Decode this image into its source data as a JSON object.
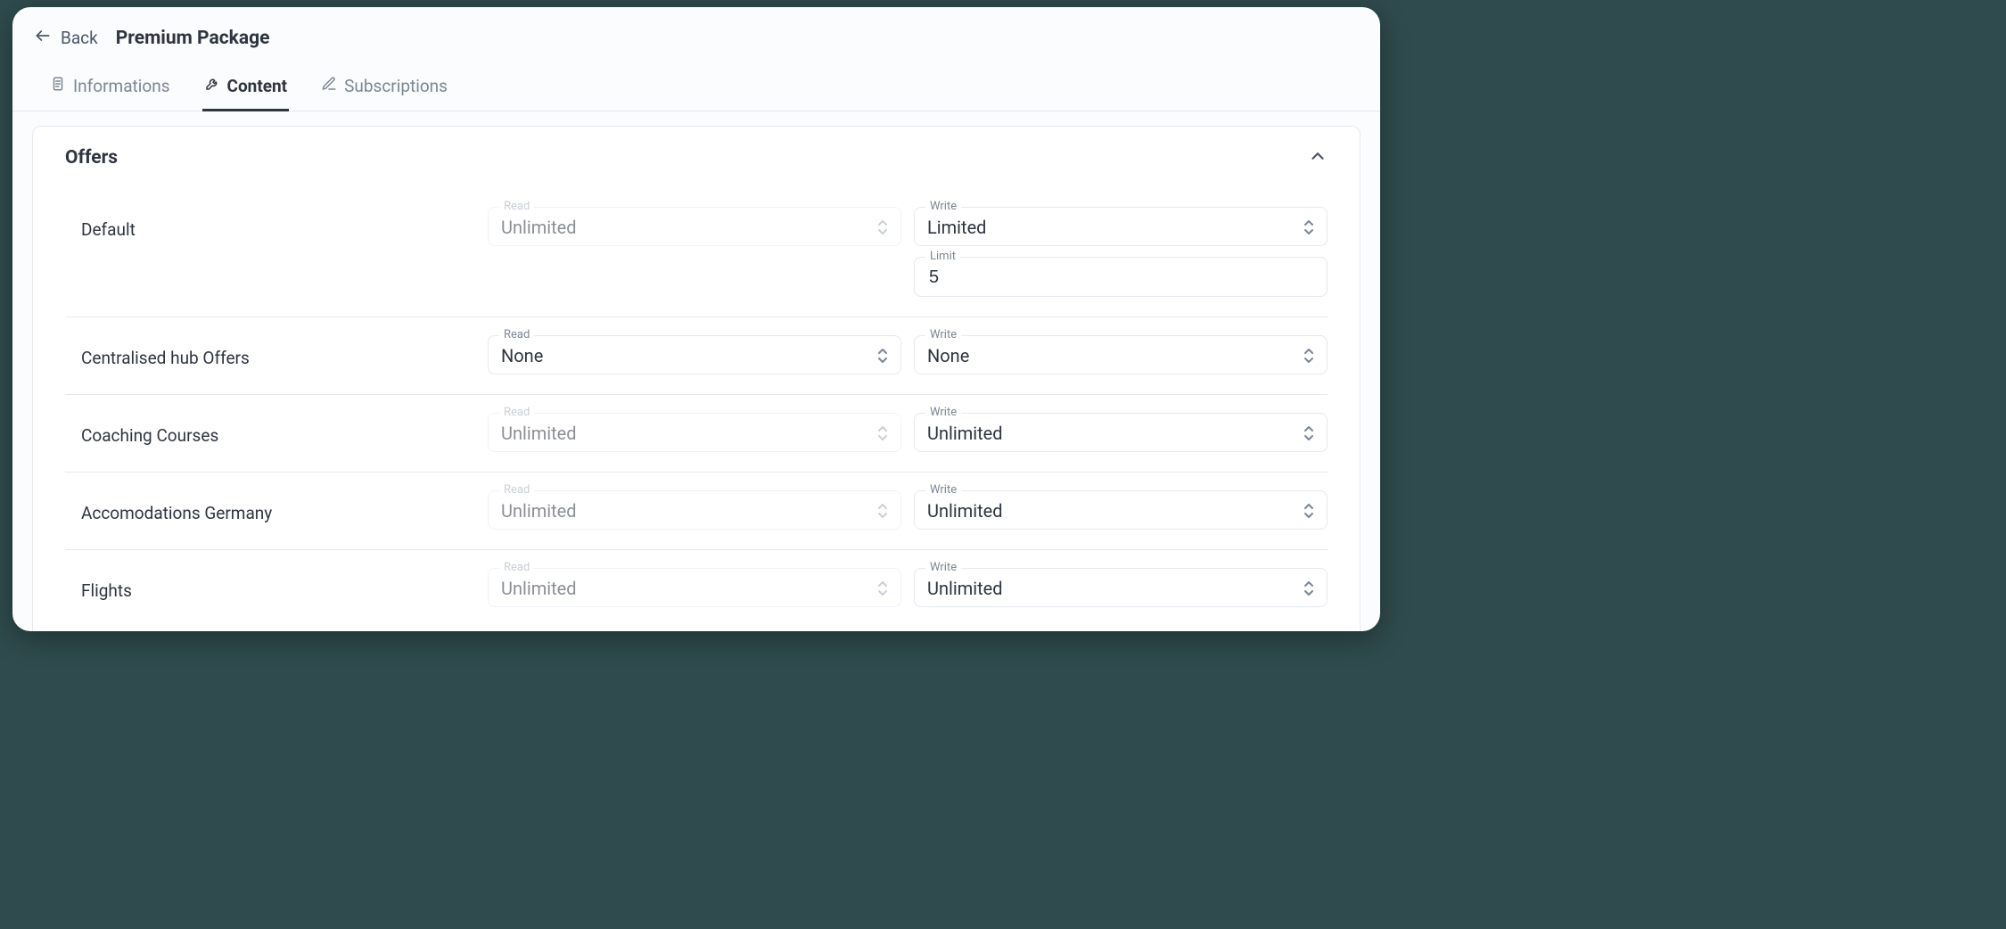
{
  "header": {
    "back_label": "Back",
    "title": "Premium Package"
  },
  "tabs": [
    {
      "label": "Informations",
      "active": false
    },
    {
      "label": "Content",
      "active": true
    },
    {
      "label": "Subscriptions",
      "active": false
    }
  ],
  "section": {
    "title": "Offers"
  },
  "field_labels": {
    "read": "Read",
    "write": "Write",
    "limit": "Limit"
  },
  "rows": [
    {
      "name": "Default",
      "read": {
        "value": "Unlimited",
        "disabled": true
      },
      "write": {
        "value": "Limited",
        "disabled": false
      },
      "limit": "5"
    },
    {
      "name": "Centralised hub Offers",
      "read": {
        "value": "None",
        "disabled": false
      },
      "write": {
        "value": "None",
        "disabled": false
      }
    },
    {
      "name": "Coaching Courses",
      "read": {
        "value": "Unlimited",
        "disabled": true
      },
      "write": {
        "value": "Unlimited",
        "disabled": false
      }
    },
    {
      "name": "Accomodations Germany",
      "read": {
        "value": "Unlimited",
        "disabled": true
      },
      "write": {
        "value": "Unlimited",
        "disabled": false
      }
    },
    {
      "name": "Flights",
      "read": {
        "value": "Unlimited",
        "disabled": true
      },
      "write": {
        "value": "Unlimited",
        "disabled": false
      }
    }
  ]
}
